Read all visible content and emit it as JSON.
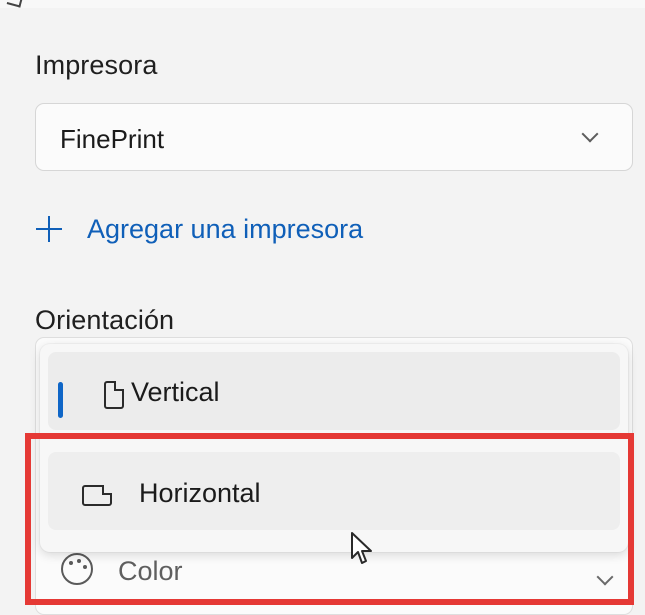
{
  "printer": {
    "label": "Impresora",
    "selected": "FinePrint",
    "add_label": "Agregar una impresora",
    "chevron_icon": "chevron-down-icon",
    "add_icon": "plus-icon"
  },
  "orientation": {
    "label": "Orientación",
    "options": [
      {
        "label": "Vertical",
        "icon": "portrait-page-icon",
        "selected": true
      },
      {
        "label": "Horizontal",
        "icon": "landscape-page-icon",
        "selected": false
      }
    ]
  },
  "color": {
    "label": "Color",
    "icon": "palette-icon",
    "chevron_icon": "chevron-down-icon"
  },
  "annotation": {
    "highlight_color": "#e53935"
  },
  "accent": {
    "link_blue": "#0f5fb8",
    "selection_blue": "#0f66c7"
  },
  "cursor": {
    "icon": "mouse-pointer-icon"
  }
}
